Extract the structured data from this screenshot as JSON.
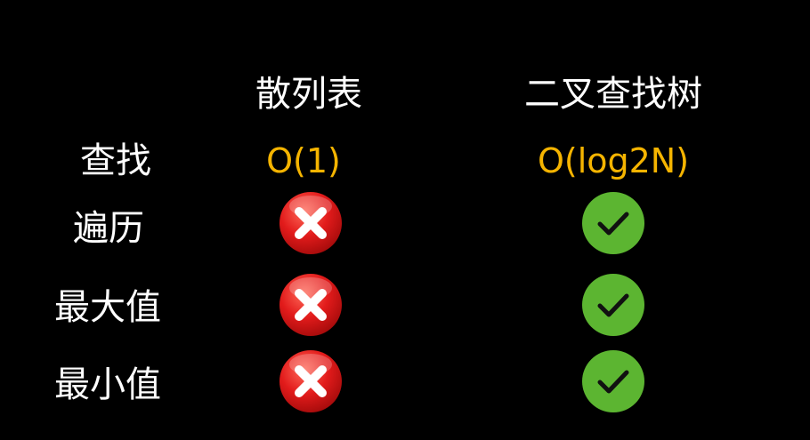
{
  "columns": {
    "hash_table": "散列表",
    "bst": "二叉查找树"
  },
  "rows": [
    {
      "label": "查找",
      "hash_table": "O(1)",
      "bst": "O(log2N)"
    },
    {
      "label": "遍历",
      "hash_table": "cross-icon",
      "bst": "check-icon"
    },
    {
      "label": "最大值",
      "hash_table": "cross-icon",
      "bst": "check-icon"
    },
    {
      "label": "最小值",
      "hash_table": "cross-icon",
      "bst": "check-icon"
    }
  ],
  "colors": {
    "background": "#000000",
    "text": "#ffffff",
    "complexity": "#f5b400",
    "cross_red": "#e21b1b",
    "check_green": "#5cb531"
  }
}
